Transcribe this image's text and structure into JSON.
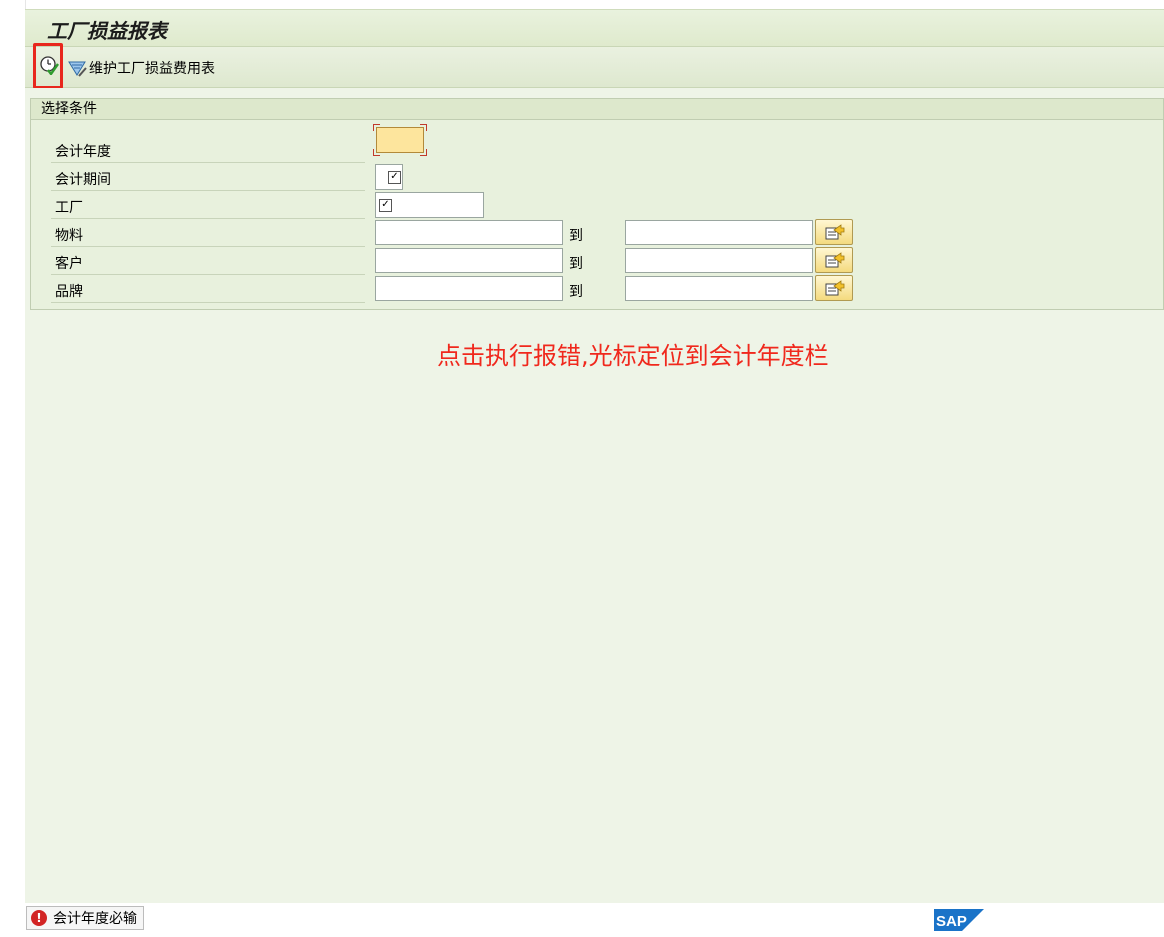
{
  "window": {
    "title": "工厂损益报表"
  },
  "toolbar": {
    "execute_icon": "execute-clock-check-icon",
    "maintain_label": "维护工厂损益费用表",
    "maintain_icon": "maintain-table-icon"
  },
  "selection": {
    "header": "选择条件",
    "rows": [
      {
        "label": "会计年度",
        "value": "",
        "required": true
      },
      {
        "label": "会计期间",
        "checkbox": true
      },
      {
        "label": "工厂",
        "checkbox": true
      },
      {
        "label": "物料",
        "to": "到"
      },
      {
        "label": "客户",
        "to": "到"
      },
      {
        "label": "品牌",
        "to": "到"
      }
    ]
  },
  "annotation": "点击执行报错,光标定位到会计年度栏",
  "status": {
    "message": "会计年度必输",
    "type": "error"
  },
  "brand": {
    "logo_text": "SAP"
  },
  "colors": {
    "required_field": "#fde59d",
    "highlight_box": "#e8271d",
    "annotation_text": "#f0281d",
    "work_area": "#eef4e7"
  }
}
